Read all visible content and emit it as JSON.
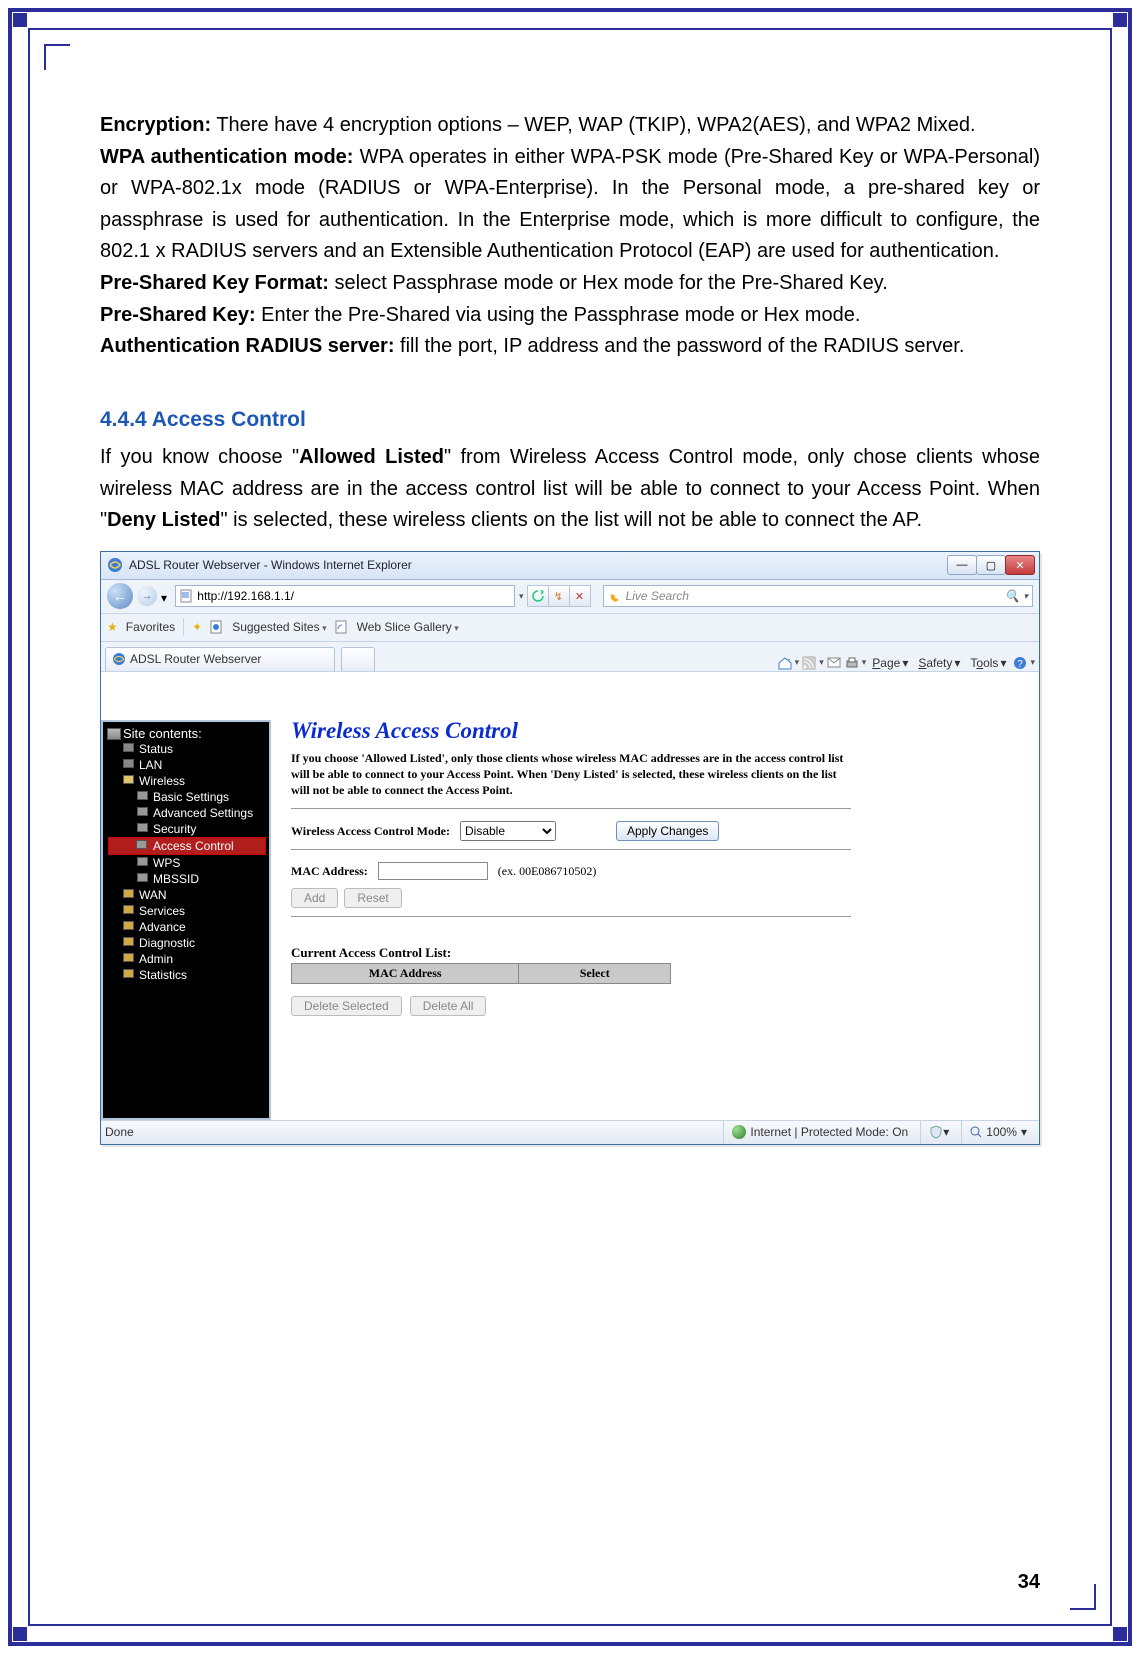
{
  "page_number": "34",
  "doc": {
    "encryption_label": "Encryption:",
    "encryption_text": " There have 4 encryption options – WEP, WAP (TKIP), WPA2(AES), and WPA2 Mixed.",
    "wpa_label": "WPA authentication mode:",
    "wpa_text": " WPA operates in either WPA-PSK mode (Pre-Shared Key or WPA-Personal) or WPA-802.1x mode (RADIUS or WPA-Enterprise). In the Personal mode, a pre-shared key or passphrase is used for authentication. In the Enterprise mode, which is more difficult to configure, the 802.1 x RADIUS servers and an Extensible Authentication Protocol (EAP) are used for authentication.",
    "pskf_label": "Pre-Shared Key Format:",
    "pskf_text": " select Passphrase mode or Hex mode for the Pre-Shared Key.",
    "psk_label": "Pre-Shared Key:",
    "psk_text": " Enter the Pre-Shared via using the Passphrase mode or Hex mode.",
    "radius_label": "Authentication RADIUS server:",
    "radius_text": " fill the port, IP address and the password of the RADIUS server.",
    "heading": "4.4.4 Access Control",
    "ac_intro_1": "If you know choose \"",
    "ac_intro_bold1": "Allowed Listed",
    "ac_intro_2": "\" from Wireless Access Control mode, only chose clients whose wireless MAC address are in the access control list will be able to connect to your Access Point. When \"",
    "ac_intro_bold2": "Deny Listed",
    "ac_intro_3": "\" is selected, these wireless clients on the list will not be able to connect the AP."
  },
  "browser": {
    "title": "ADSL Router Webserver - Windows Internet Explorer",
    "url": "http://192.168.1.1/",
    "search_placeholder": "Live Search",
    "fav_label": "Favorites",
    "suggested": "Suggested Sites",
    "webslice": "Web Slice Gallery",
    "tab_title": "ADSL Router Webserver",
    "menu_page": "Page",
    "menu_safety": "Safety",
    "menu_tools": "Tools",
    "status_done": "Done",
    "status_zone": "Internet | Protected Mode: On",
    "zoom": "100%"
  },
  "sidebar": {
    "title": "Site contents:",
    "items": [
      {
        "label": "Status",
        "level": 1,
        "type": "page"
      },
      {
        "label": "LAN",
        "level": 1,
        "type": "page"
      },
      {
        "label": "Wireless",
        "level": 1,
        "type": "folder-open"
      },
      {
        "label": "Basic Settings",
        "level": 2,
        "type": "page"
      },
      {
        "label": "Advanced Settings",
        "level": 2,
        "type": "page"
      },
      {
        "label": "Security",
        "level": 2,
        "type": "page"
      },
      {
        "label": "Access Control",
        "level": 2,
        "type": "page",
        "selected": true
      },
      {
        "label": "WPS",
        "level": 2,
        "type": "page"
      },
      {
        "label": "MBSSID",
        "level": 2,
        "type": "page"
      },
      {
        "label": "WAN",
        "level": 1,
        "type": "folder"
      },
      {
        "label": "Services",
        "level": 1,
        "type": "folder"
      },
      {
        "label": "Advance",
        "level": 1,
        "type": "folder"
      },
      {
        "label": "Diagnostic",
        "level": 1,
        "type": "folder"
      },
      {
        "label": "Admin",
        "level": 1,
        "type": "folder"
      },
      {
        "label": "Statistics",
        "level": 1,
        "type": "folder"
      }
    ]
  },
  "router": {
    "heading": "Wireless Access Control",
    "desc": "If you choose 'Allowed Listed', only those clients whose wireless MAC addresses are in the access control list will be able to connect to your Access Point. When 'Deny Listed' is selected, these wireless clients on the list will not be able to connect the Access Point.",
    "mode_label": "Wireless Access Control Mode:",
    "mode_value": "Disable",
    "apply": "Apply Changes",
    "mac_label": "MAC Address:",
    "mac_hint": "(ex. 00E086710502)",
    "btn_add": "Add",
    "btn_reset": "Reset",
    "acl_heading": "Current Access Control List:",
    "col_mac": "MAC Address",
    "col_select": "Select",
    "btn_delsel": "Delete Selected",
    "btn_delall": "Delete All"
  }
}
